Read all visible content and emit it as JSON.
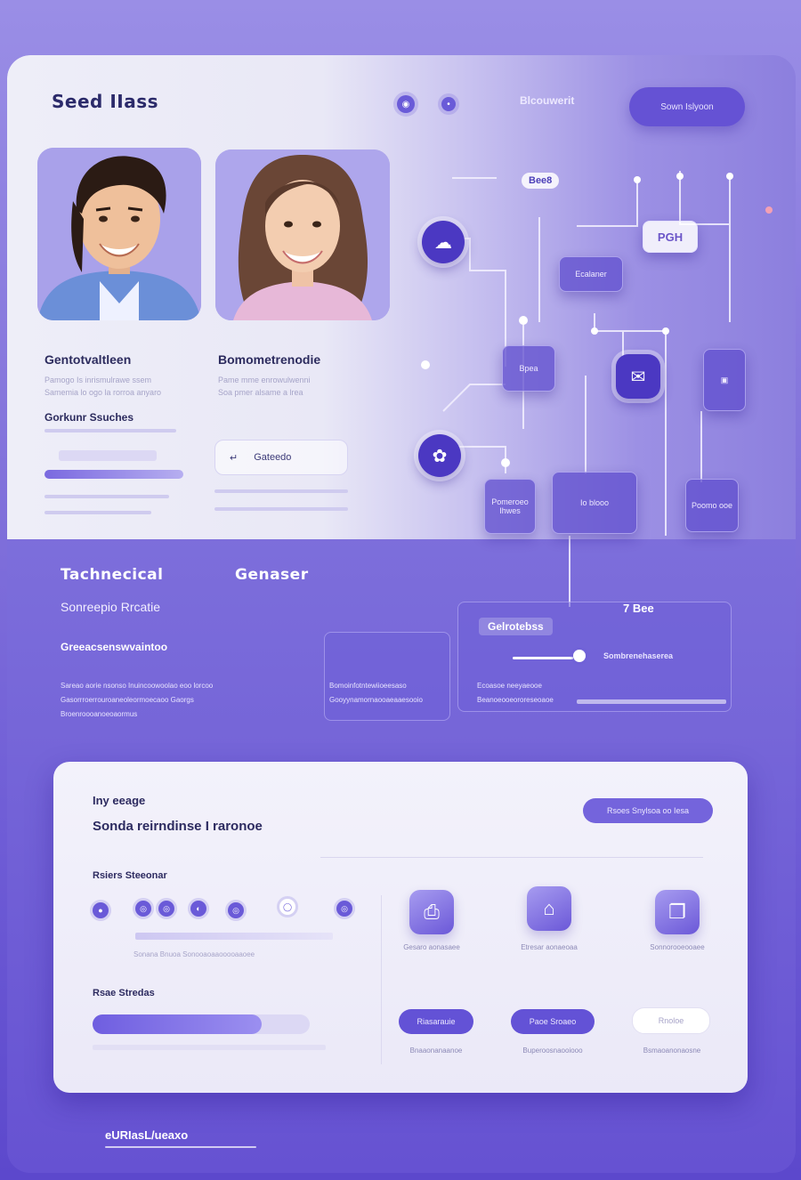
{
  "header": {
    "brand": "Seed IIass",
    "nav_link": "Blcouwerit",
    "cta": "Sown Islyoon"
  },
  "profiles": [
    {
      "name": "Gentotvaltleen",
      "desc_1": "Pamogo Is inrismulrawe ssem",
      "desc_2": "Samemia lo ogo la rorroa anyaro"
    },
    {
      "name": "Bomometrenodie",
      "desc_1": "Pame mme enrowulwenni",
      "desc_2": "Soa pmer alsame a lrea"
    }
  ],
  "profile_section": {
    "label": "Gorkunr Ssuches",
    "input_value": "Gateedo"
  },
  "network": {
    "top_tag": "Bee8",
    "card_1": "Ecalaner",
    "card_2": "PGH",
    "card_3": "Bpea",
    "card_4": "Pomeroeo Ihwes",
    "card_5": "Io blooo",
    "card_6": "Poomo ooe"
  },
  "mid_section": {
    "title_1": "Tachnecical",
    "title_2": "Genaser",
    "subtitle": "Sonreepio Rrcatie",
    "caption": "Greeacsenswvaintoo",
    "body_1": "Sareao aorie nsonso Inuincoowoolao eoo lorcoo",
    "body_2": "Gasorrroerrouroaneoleormoecaoo Gaorgs",
    "body_3": "Broenroooanoeoaormus",
    "col2_1": "Bomoinfotntewiioeesaso",
    "col2_2": "Gooyynamornaooaeaaesooio",
    "col3_1": "Ecoasoe neeyaeooe",
    "col3_2": "Beanoeooeororeseoaoe",
    "card_title": "Gelrotebss",
    "card_badge": "7 Bee",
    "card_field": "Sombrenehaserea"
  },
  "bottom_panel": {
    "eyebrow": "Iny eeage",
    "heading": "Sonda reirndinse I raronoe",
    "pill": "Rsoes Snylsoa oo Iesa",
    "steps_label": "Rsiers Steeonar",
    "steps_caption": "Sonana Bnuoa Sonooaoaaooooaaoee",
    "features": [
      {
        "icon": "printer-icon",
        "label": "Gesaro aonasaee"
      },
      {
        "icon": "building-icon",
        "label": "Etresar aonaeoaa"
      },
      {
        "icon": "documents-icon",
        "label": "Sonnorooeooaee"
      }
    ],
    "progress_label": "Rsae Stredas",
    "progress_value": 0.78,
    "actions": [
      {
        "label": "Riasarauie",
        "sub": "Bnaaonanaanoe",
        "style": "primary"
      },
      {
        "label": "Paoe Sroaeo",
        "sub": "Buperoosnaooiooo",
        "style": "primary"
      },
      {
        "label": "Rnoloe",
        "sub": "Bsmaoanonaosne",
        "style": "ghost"
      }
    ]
  },
  "footer": {
    "text": "eURIasL/ueaxo"
  },
  "colors": {
    "accent": "#6552d4",
    "accent_light": "#7464dc",
    "panel": "#f3f2fb",
    "text_dark": "#2c2b5e"
  }
}
